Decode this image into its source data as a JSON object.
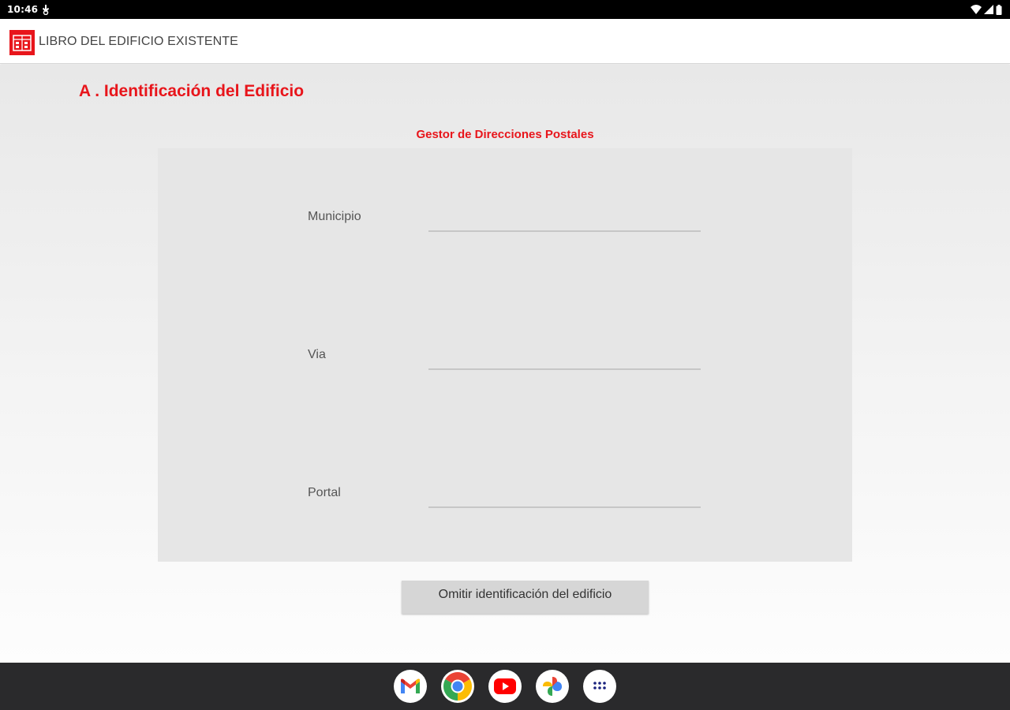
{
  "status_bar": {
    "time": "10:46",
    "left_icons": [
      "download-icon"
    ],
    "right_icons": [
      "wifi-icon",
      "signal-icon",
      "battery-icon"
    ]
  },
  "app_bar": {
    "logo_icon": "building-book-logo-icon",
    "title": "LIBRO DEL EDIFICIO EXISTENTE"
  },
  "main": {
    "section_title": "A . Identificación del Edificio",
    "subsection_title": "Gestor de Direcciones Postales",
    "fields": [
      {
        "label": "Municipio",
        "value": ""
      },
      {
        "label": "Via",
        "value": ""
      },
      {
        "label": "Portal",
        "value": ""
      }
    ],
    "skip_button_label": "Omitir identificación del edificio"
  },
  "dock": {
    "apps": [
      "gmail-icon",
      "chrome-icon",
      "youtube-icon",
      "photos-icon",
      "app-drawer-icon"
    ]
  },
  "colors": {
    "accent": "#e8151b",
    "panel": "#e6e6e6",
    "button": "#d6d6d6",
    "taskbar": "#2a2a2c"
  }
}
